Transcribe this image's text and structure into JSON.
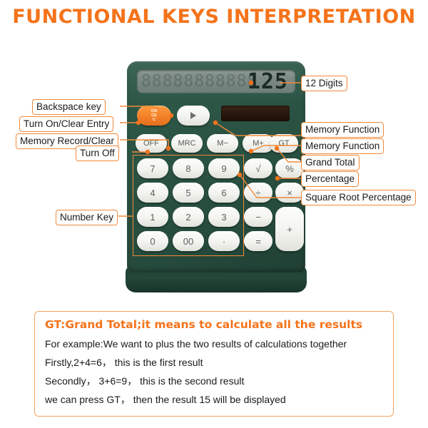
{
  "page": {
    "title": "FUNCTIONAL KEYS INTERPRETATION",
    "title_color": "#f5731a",
    "accent_color": "#f08a3c",
    "body_color": "#2b5444"
  },
  "calculator": {
    "display": {
      "value": "125",
      "ghost": "88888888888",
      "digits_note": "12 Digits"
    },
    "solar_panel": "solar-panel",
    "top_keys": [
      {
        "label": "ON\nCE\nC",
        "name": "on-clear-entry-key",
        "type": "orange"
      },
      {
        "label": "▶",
        "name": "backspace-key",
        "type": "arrow"
      }
    ],
    "function_keys": [
      {
        "label": "OFF",
        "name": "off-key"
      },
      {
        "label": "MRC",
        "name": "memory-recall-clear-key"
      },
      {
        "label": "M−",
        "name": "memory-minus-key"
      },
      {
        "label": "M+",
        "name": "memory-plus-key"
      },
      {
        "label": "GT",
        "name": "grand-total-key"
      }
    ],
    "keypad_rows": [
      [
        "7",
        "8",
        "9",
        "√",
        "%"
      ],
      [
        "4",
        "5",
        "6",
        "÷",
        "×"
      ],
      [
        "1",
        "2",
        "3",
        "−",
        "+"
      ],
      [
        "0",
        "00",
        "·",
        "=",
        ""
      ]
    ]
  },
  "callouts": {
    "left": [
      {
        "label": "Backspace key",
        "name": "callout-backspace-key"
      },
      {
        "label": "Turn On/Clear Entry",
        "name": "callout-turn-on-clear-entry"
      },
      {
        "label": "Memory Record/Clear",
        "name": "callout-memory-record-clear"
      },
      {
        "label": "Turn Off",
        "name": "callout-turn-off"
      },
      {
        "label": "Number Key",
        "name": "callout-number-key"
      }
    ],
    "right": [
      {
        "label": "12 Digits",
        "name": "callout-12-digits"
      },
      {
        "label": "Memory Function",
        "name": "callout-memory-function-minus"
      },
      {
        "label": "Memory Function",
        "name": "callout-memory-function-plus"
      },
      {
        "label": "Grand Total",
        "name": "callout-grand-total"
      },
      {
        "label": "Percentage",
        "name": "callout-percentage"
      },
      {
        "label": "Square Root Percentage",
        "name": "callout-square-root-percentage"
      }
    ]
  },
  "explanation": {
    "heading": "GT:Grand Total;it means to calculate all the results",
    "lines": [
      "For example:We want to plus the two  results of calculations together",
      "Firstly,2+4=6， this is the first result",
      "Secondly， 3+6=9， this is the second result",
      "we can press GT， then the result 15 will be displayed"
    ]
  }
}
